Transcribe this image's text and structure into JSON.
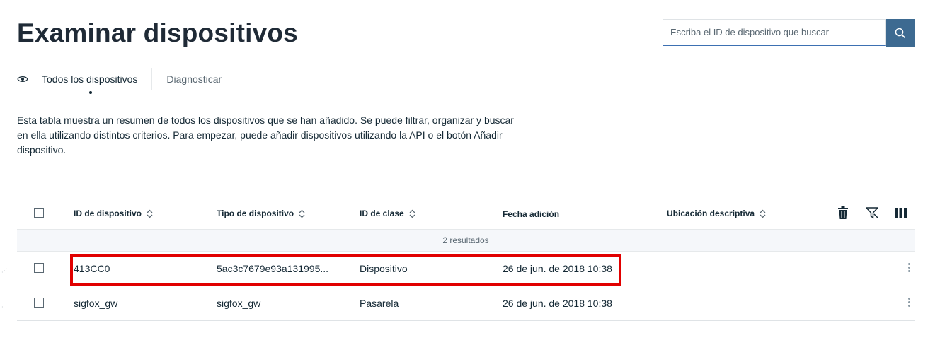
{
  "page": {
    "title": "Examinar dispositivos",
    "description": "Esta tabla muestra un resumen de todos los dispositivos que se han añadido. Se puede filtrar, organizar y buscar en ella utilizando distintos criterios. Para empezar, puede añadir dispositivos utilizando la API o el botón Añadir dispositivo."
  },
  "search": {
    "placeholder": "Escriba el ID de dispositivo que buscar",
    "icon": "search-icon"
  },
  "tabs": [
    {
      "label": "Todos los dispositivos",
      "icon": "eye-icon",
      "active": true
    },
    {
      "label": "Diagnosticar",
      "active": false
    }
  ],
  "table": {
    "columns": [
      {
        "label": "ID de dispositivo",
        "sortable": true
      },
      {
        "label": "Tipo de dispositivo",
        "sortable": true
      },
      {
        "label": "ID de clase",
        "sortable": true
      },
      {
        "label": "Fecha adición",
        "sortable": false
      },
      {
        "label": "Ubicación descriptiva",
        "sortable": true
      }
    ],
    "toolbar_icons": [
      "trash-icon",
      "filter-icon",
      "columns-icon"
    ],
    "results_label": "2 resultados",
    "rows": [
      {
        "device_id": "413CC0",
        "device_type": "5ac3c7679e93a131995...",
        "class_id": "Dispositivo",
        "date_added": "26 de jun. de 2018 10:38",
        "location": ""
      },
      {
        "device_id": "sigfox_gw",
        "device_type": "sigfox_gw",
        "class_id": "Pasarela",
        "date_added": "26 de jun. de 2018 10:38",
        "location": ""
      }
    ]
  },
  "colors": {
    "search_button": "#3d6a91",
    "highlight": "#e10000",
    "text": "#152935"
  }
}
